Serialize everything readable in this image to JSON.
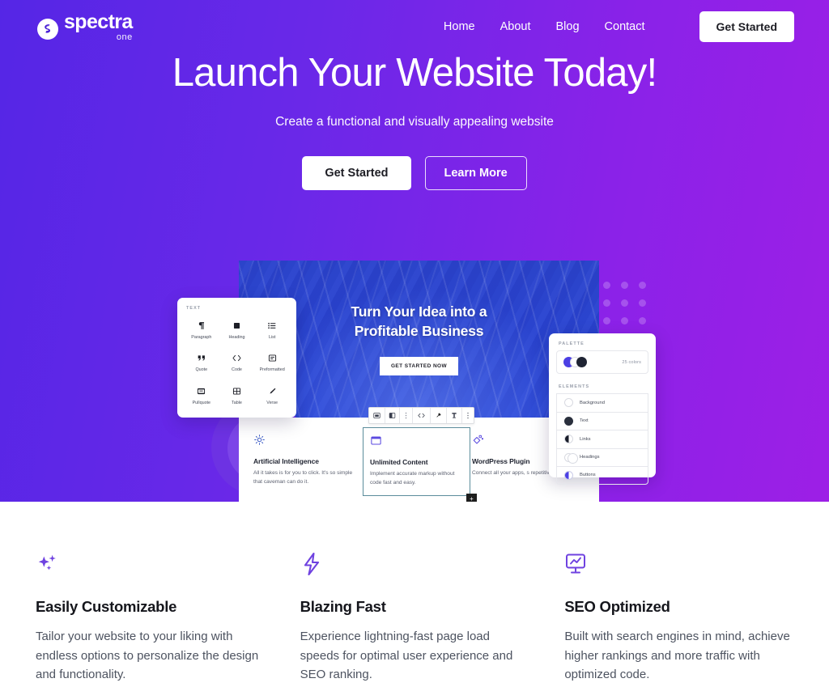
{
  "brand": {
    "name": "spectra",
    "sub": "one",
    "logo_icon": "spectra-s-logo-icon"
  },
  "nav": {
    "links": [
      {
        "label": "Home"
      },
      {
        "label": "About"
      },
      {
        "label": "Blog"
      },
      {
        "label": "Contact"
      }
    ],
    "cta_label": "Get Started"
  },
  "hero": {
    "title": "Launch Your Website Today!",
    "subtitle": "Create a functional and visually appealing website",
    "primary_button": "Get Started",
    "secondary_button": "Learn More"
  },
  "mockup": {
    "banner_title": "Turn Your Idea into a Profitable Business",
    "banner_button": "GET STARTED NOW",
    "toolbar_icons": [
      "block-type-icon",
      "align-icon",
      "drag-handle-icon",
      "code-icon",
      "link-icon",
      "bold-icon",
      "more-options-icon"
    ],
    "cards": [
      {
        "icon": "gear-icon",
        "title": "Artificial Intelligence",
        "desc": "All it takes is for you to click. It's so simple that caveman can do it."
      },
      {
        "icon": "window-icon",
        "title": "Unlimited Content",
        "desc": "Implement accurate markup without code fast and easy.",
        "selected": true,
        "plus_label": "+"
      },
      {
        "icon": "plugin-icon",
        "title": "WordPress Plugin",
        "desc": "Connect all your apps, s repetitive tasks."
      }
    ]
  },
  "text_panel": {
    "label": "TEXT",
    "blocks": [
      {
        "name": "Paragraph",
        "icon": "paragraph-icon"
      },
      {
        "name": "Heading",
        "icon": "heading-icon"
      },
      {
        "name": "List",
        "icon": "list-icon"
      },
      {
        "name": "Quote",
        "icon": "quote-icon"
      },
      {
        "name": "Code",
        "icon": "code-icon"
      },
      {
        "name": "Preformatted",
        "icon": "preformatted-icon"
      },
      {
        "name": "Pullquote",
        "icon": "pullquote-icon"
      },
      {
        "name": "Table",
        "icon": "table-icon"
      },
      {
        "name": "Verse",
        "icon": "verse-icon"
      }
    ]
  },
  "palette_panel": {
    "palette_label": "PALETTE",
    "color_count": "25 colors",
    "elements_label": "ELEMENTS",
    "elements": [
      {
        "name": "Background",
        "swatch": "empty"
      },
      {
        "name": "Text",
        "swatch": "dark"
      },
      {
        "name": "Links",
        "swatch": "half-dark"
      },
      {
        "name": "Headings",
        "swatch": "double"
      },
      {
        "name": "Buttons",
        "swatch": "half-blue"
      }
    ]
  },
  "features": [
    {
      "icon": "sparkles-icon",
      "title": "Easily Customizable",
      "desc": "Tailor your website to your liking with endless options to personalize the design and functionality."
    },
    {
      "icon": "lightning-bolt-icon",
      "title": "Blazing Fast",
      "desc": "Experience lightning-fast page load speeds for optimal user experience and SEO ranking."
    },
    {
      "icon": "seo-chart-board-icon",
      "title": "SEO Optimized",
      "desc": "Built with search engines in mind, achieve higher rankings and more traffic with optimized code."
    }
  ],
  "colors": {
    "gradient_start": "#5526e6",
    "gradient_end": "#9d1fe6",
    "accent": "#6f42e0",
    "text_dark": "#15161c",
    "text_muted": "#4d5360"
  }
}
